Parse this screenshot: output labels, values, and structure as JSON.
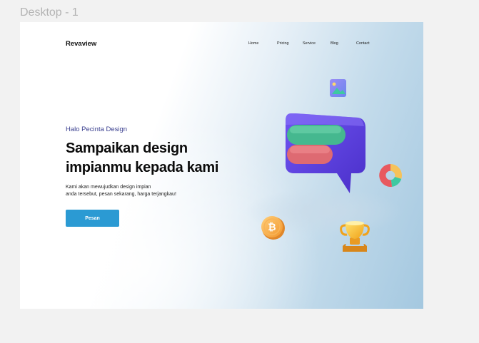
{
  "canvas": {
    "frame_label": "Desktop - 1"
  },
  "header": {
    "brand": "Revaview",
    "nav": [
      "Home",
      "Pricing",
      "Service",
      "Blog",
      "Contact"
    ]
  },
  "hero": {
    "eyebrow": "Halo Pecinta Design",
    "headline": [
      "Sampaikan design",
      "impianmu kepada kami"
    ],
    "description": [
      "Kami akan mewujudkan  design impian",
      "anda tersebut, pesan sekarang, harga terjangkau!"
    ],
    "cta_label": "Pesan"
  },
  "illustration": {
    "icons": [
      "chat-bubble-icon",
      "image-icon",
      "pie-chart-icon",
      "bitcoin-icon",
      "trophy-icon"
    ]
  },
  "colors": {
    "cta": "#2b9ad3",
    "eyebrow": "#3a3f8f",
    "chat_bubble": "#5a3ee0",
    "bar_green": "#45b88f",
    "bar_red": "#de6a72"
  }
}
